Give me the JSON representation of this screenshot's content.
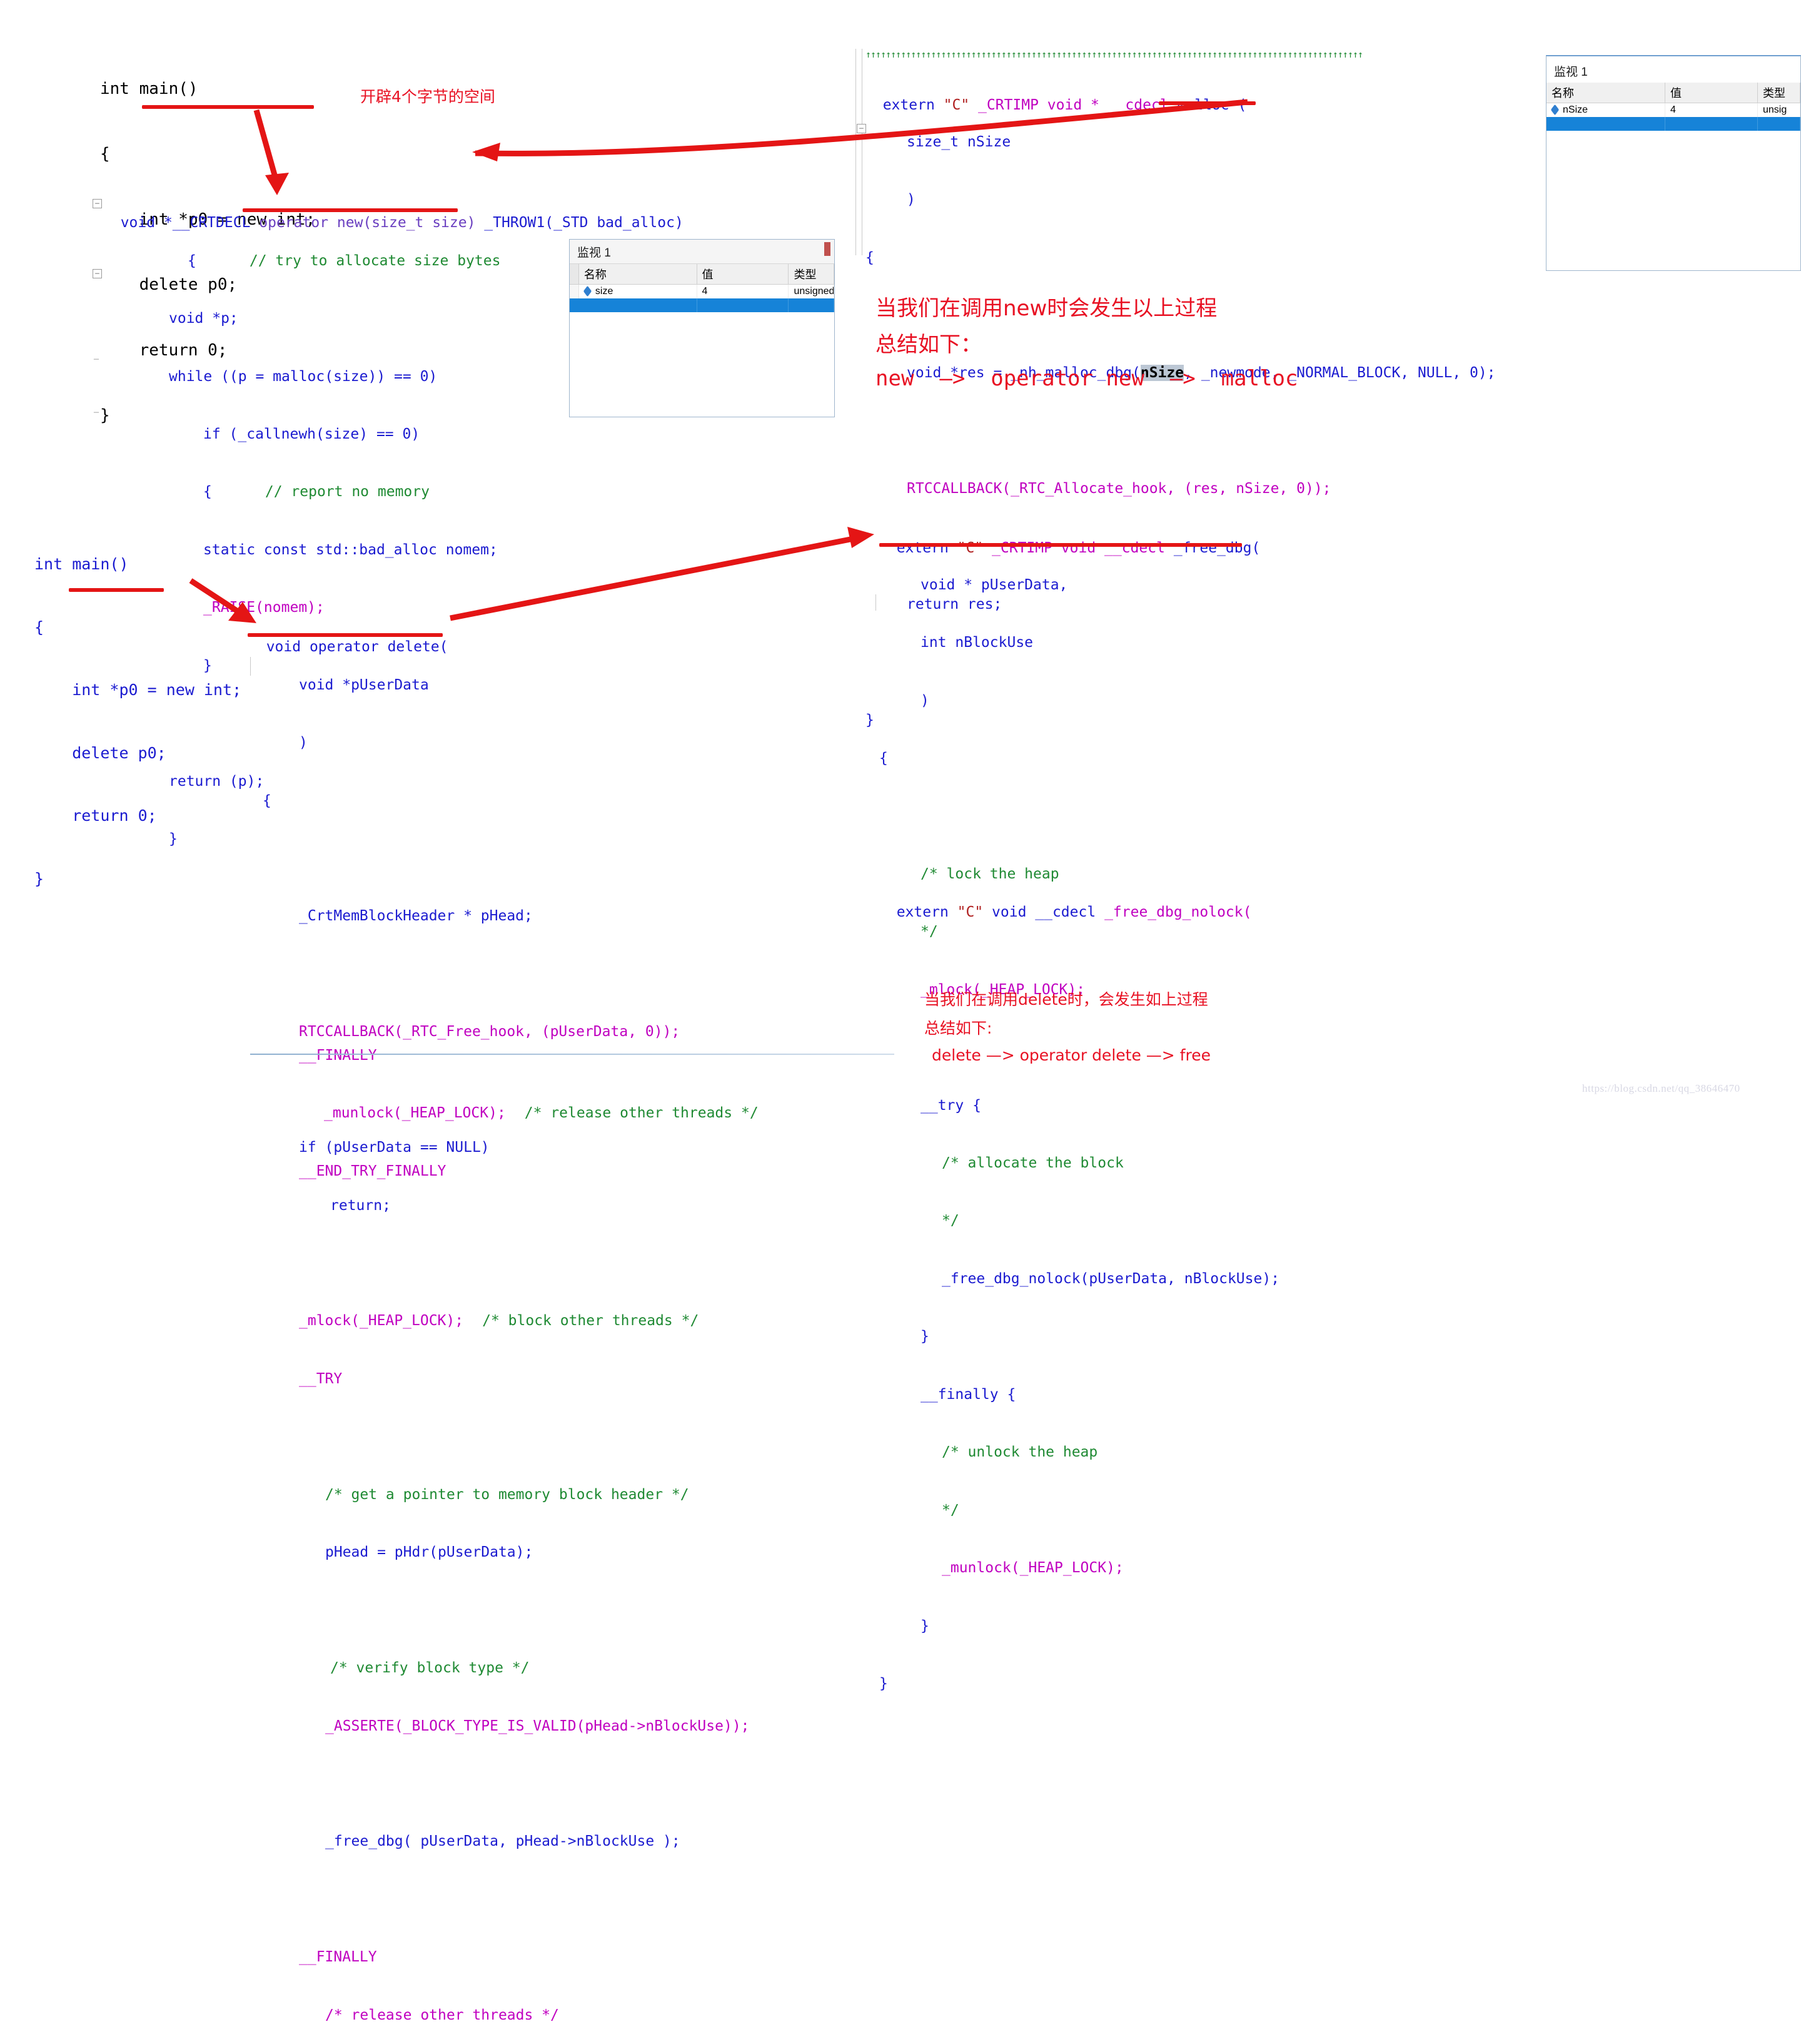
{
  "meta": {
    "watermark": "https://blog.csdn.net/qq_38646470"
  },
  "top_left": {
    "main_code": [
      "int main()",
      "{",
      "    int *p0 = new int;",
      "    delete p0;",
      "    return 0;",
      "}"
    ],
    "annotation_note": "开辟4个字节的空间",
    "operator_new": {
      "signature_prefix": "void *__CRTDECL ",
      "signature_name": "operator new(size_t size)",
      "signature_suffix": " _THROW1(_STD bad_alloc)",
      "lines": [
        {
          "indent": 9,
          "text": "{",
          "comment": "// try to allocate size bytes"
        },
        {
          "indent": 7,
          "text": "void *p;"
        },
        {
          "indent": 7,
          "text": "while ((p = malloc(size)) == 0)"
        },
        {
          "indent": 11,
          "text": "if (_callnewh(size) == 0)"
        },
        {
          "indent": 11,
          "text": "{",
          "comment": "// report no memory"
        },
        {
          "indent": 11,
          "text": "static const std::bad_alloc nomem;"
        },
        {
          "indent": 11,
          "text": "_RAISE(nomem);"
        },
        {
          "indent": 11,
          "text": "}"
        },
        {
          "indent": 0,
          "text": ""
        },
        {
          "indent": 7,
          "text": "return (p);"
        },
        {
          "indent": 7,
          "text": "}"
        }
      ]
    }
  },
  "watch_size": {
    "title": "监视 1",
    "columns": [
      "名称",
      "值",
      "类型"
    ],
    "rows": [
      {
        "name": "size",
        "value": "4",
        "type": "unsigned"
      }
    ]
  },
  "top_right": {
    "separator": "↑↑↑↑↑↑↑↑↑↑↑↑↑↑↑↑↑↑↑↑↑↑↑↑↑↑↑↑↑↑↑↑↑↑↑↑↑↑↑↑↑↑↑↑↑↑↑↑↑↑↑↑↑↑↑↑↑↑↑↑↑↑↑↑↑↑↑↑↑↑↑↑↑↑↑↑↑↑↑↑↑↑↑↑↑↑↑↑↑↑↑↑↑↑↑↑↑↑↑",
    "malloc_code": {
      "header_extern": "extern ",
      "header_c": "\"C\"",
      "header_rest": " _CRTIMP void * __cdecl ",
      "header_name": "malloc (",
      "lines": [
        {
          "indent": 8,
          "text": "size_t nSize"
        },
        {
          "indent": 8,
          "text": ")"
        },
        {
          "indent": 0,
          "text": "{"
        },
        {
          "indent": 0,
          "text": ""
        },
        {
          "indent": 8,
          "text": "void *res = _nh_malloc_dbg(",
          "hl": "nSize",
          "tail": ", _newmode, _NORMAL_BLOCK, NULL, 0);"
        },
        {
          "indent": 0,
          "text": ""
        },
        {
          "indent": 8,
          "text": "RTCCALLBACK(_RTC_Allocate_hook, (res, nSize, 0));"
        },
        {
          "indent": 0,
          "text": ""
        },
        {
          "indent": 8,
          "text": "return res;"
        },
        {
          "indent": 0,
          "text": ""
        },
        {
          "indent": 0,
          "text": "}"
        }
      ]
    }
  },
  "watch_nsize": {
    "title": "监视 1",
    "columns": [
      "名称",
      "值",
      "类型"
    ],
    "rows": [
      {
        "name": "nSize",
        "value": "4",
        "type": "unsig"
      }
    ]
  },
  "new_summary": {
    "line1": "当我们在调用new时会发生以上过程",
    "line2": "总结如下：",
    "line3": "new  —>  operator new  —>  malloc"
  },
  "bottom_left": {
    "main_code": [
      "int main()",
      "{",
      "    int *p0 = new int;",
      "    delete p0;",
      "    return 0;",
      "}"
    ],
    "operator_delete": {
      "signature": "void operator delete(",
      "lines": [
        {
          "indent": 6,
          "text": "void *pUserData"
        },
        {
          "indent": 6,
          "text": ")"
        },
        {
          "indent": 2,
          "text": "{"
        },
        {
          "indent": 0,
          "text": ""
        },
        {
          "indent": 6,
          "text": "_CrtMemBlockHeader * pHead;"
        },
        {
          "indent": 0,
          "text": ""
        },
        {
          "indent": 6,
          "text": "RTCCALLBACK(_RTC_Free_hook, (pUserData, 0));"
        },
        {
          "indent": 0,
          "text": ""
        },
        {
          "indent": 6,
          "text": "if (pUserData == NULL)"
        },
        {
          "indent": 10,
          "text": "return;"
        },
        {
          "indent": 0,
          "text": ""
        },
        {
          "indent": 6,
          "text": "_mlock(_HEAP_LOCK);",
          "comment": "/* block other threads */"
        },
        {
          "indent": 6,
          "text": "__TRY"
        },
        {
          "indent": 0,
          "text": ""
        },
        {
          "indent": 9,
          "text": "",
          "comment": "/* get a pointer to memory block header */"
        },
        {
          "indent": 9,
          "text": "pHead = pHdr(pUserData);"
        },
        {
          "indent": 0,
          "text": ""
        },
        {
          "indent": 10,
          "text": "",
          "comment": "/* verify block type */"
        },
        {
          "indent": 9,
          "text": "_ASSERTE(_BLOCK_TYPE_IS_VALID(pHead->nBlockUse));"
        },
        {
          "indent": 0,
          "text": ""
        },
        {
          "indent": 9,
          "text": "_free_dbg( pUserData, pHead->nBlockUse );"
        },
        {
          "indent": 0,
          "text": ""
        },
        {
          "indent": 6,
          "text": "__FINALLY"
        },
        {
          "indent": 9,
          "text": "_munlock(_HEAP_LOCK);",
          "comment": "/* release other threads */"
        },
        {
          "indent": 6,
          "text": "__END_TRY_FINALLY"
        }
      ]
    }
  },
  "bottom_right": {
    "free_dbg": {
      "header_extern": "extern ",
      "header_c": "\"C\"",
      "header_rest": " _CRTIMP void __cdecl ",
      "header_name": "_free_dbg(",
      "lines": [
        {
          "indent": 8,
          "text": "void * pUserData,"
        },
        {
          "indent": 8,
          "text": "int nBlockUse"
        },
        {
          "indent": 8,
          "text": ")"
        },
        {
          "indent": 0,
          "text": "{"
        },
        {
          "indent": 0,
          "text": ""
        },
        {
          "indent": 8,
          "text": "",
          "comment": "/* lock the heap"
        },
        {
          "indent": 8,
          "text": "",
          "comment": "*/"
        },
        {
          "indent": 8,
          "text": "_mlock(_HEAP_LOCK);"
        },
        {
          "indent": 0,
          "text": ""
        },
        {
          "indent": 8,
          "text": "__try {"
        },
        {
          "indent": 12,
          "text": "",
          "comment": "/* allocate the block"
        },
        {
          "indent": 12,
          "text": "",
          "comment": "*/"
        },
        {
          "indent": 12,
          "text": "_free_dbg_nolock(pUserData, nBlockUse);"
        },
        {
          "indent": 8,
          "text": "}"
        },
        {
          "indent": 8,
          "text": "__finally {"
        },
        {
          "indent": 12,
          "text": "",
          "comment": "/* unlock the heap"
        },
        {
          "indent": 12,
          "text": "",
          "comment": "*/"
        },
        {
          "indent": 12,
          "text": "_munlock(_HEAP_LOCK);"
        },
        {
          "indent": 8,
          "text": "}"
        },
        {
          "indent": 0,
          "text": "}"
        }
      ]
    },
    "free_dbg_nolock": {
      "header_extern": "extern ",
      "header_c": "\"C\"",
      "header_rest": " void __cdecl ",
      "header_name": "_free_dbg_nolock(",
      "lines": [
        {
          "indent": 0,
          "text": ""
        },
        {
          "indent": 8,
          "text": "void * pUserData"
        }
      ]
    }
  },
  "delete_summary": {
    "line1": "当我们在调用delete时，会发生如上过程",
    "line2": "总结如下:",
    "line3": "delete  —>  operator delete  —> free"
  }
}
